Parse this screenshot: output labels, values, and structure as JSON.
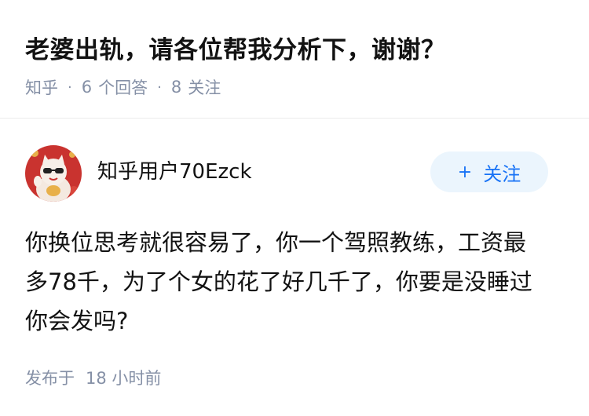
{
  "question": {
    "title": "老婆出轨，请各位帮我分析下，谢谢？",
    "source": "知乎",
    "answers_count": "6",
    "answers_label": "个回答",
    "followers_count": "8",
    "followers_label": "关注"
  },
  "author": {
    "name": "知乎用户70Ezck",
    "follow_plus": "+",
    "follow_label": "关注"
  },
  "answer": {
    "lines": [
      "你换位思考就很容易了，你一个驾照教练，工资最",
      "多78千，为了个女的花了好几千了，你要是没睡过",
      "你会发吗?"
    ]
  },
  "footer": {
    "published_label": "发布于",
    "published_time": "18 小时前"
  },
  "colors": {
    "accent": "#1772f6",
    "follow_bg": "#ebf5fd",
    "meta_gray": "#8590a6"
  }
}
